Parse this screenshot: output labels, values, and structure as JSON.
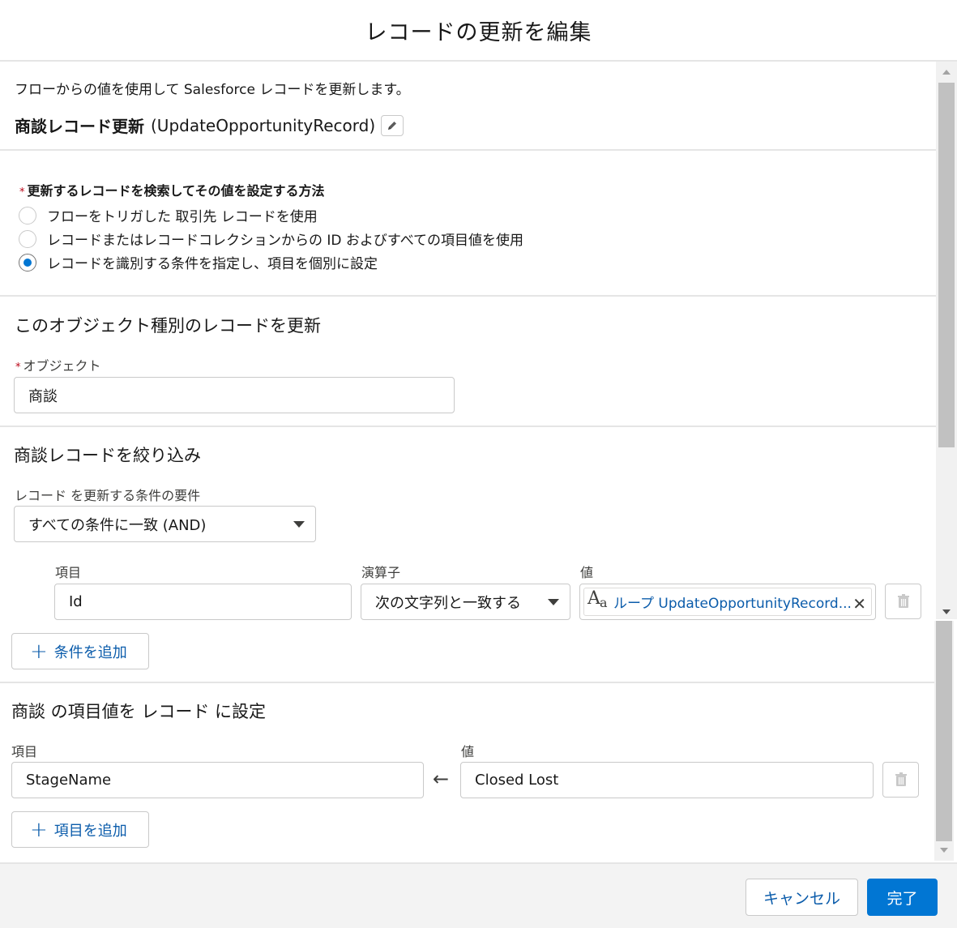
{
  "modal": {
    "title": "レコードの更新を編集"
  },
  "intro": {
    "description": "フローからの値を使用して Salesforce レコードを更新します。",
    "element_label": "商談レコード更新",
    "element_api_name": "(UpdateOpportunityRecord)"
  },
  "method": {
    "label": "更新するレコードを検索してその値を設定する方法",
    "required_marker": "*",
    "options": [
      {
        "label": "フローをトリガした 取引先 レコードを使用",
        "selected": false
      },
      {
        "label": "レコードまたはレコードコレクションからの ID およびすべての項目値を使用",
        "selected": false
      },
      {
        "label": "レコードを識別する条件を指定し、項目を個別に設定",
        "selected": true
      }
    ]
  },
  "object_section": {
    "title": "このオブジェクト種別のレコードを更新",
    "object_label": "オブジェクト",
    "required_marker": "*",
    "object_value": "商談"
  },
  "filter_section": {
    "title": "商談レコードを絞り込み",
    "requirement_label": "レコード を更新する条件の要件",
    "requirement_value": "すべての条件に一致 (AND)",
    "columns": {
      "field": "項目",
      "operator": "演算子",
      "value": "値"
    },
    "conditions": [
      {
        "field": "Id",
        "operator": "次の文字列と一致する",
        "value_icon": "text-variable-icon",
        "value_icon_big": "A",
        "value_icon_small": "a",
        "value": "ループ UpdateOpportunityRecord..."
      }
    ],
    "add_condition_label": "条件を追加"
  },
  "assign_section": {
    "title": "商談 の項目値を レコード に設定",
    "columns": {
      "field": "項目",
      "value": "値"
    },
    "assignments": [
      {
        "field": "StageName",
        "value": "Closed Lost"
      }
    ],
    "add_field_label": "項目を追加"
  },
  "footer": {
    "cancel_label": "キャンセル",
    "done_label": "完了"
  },
  "colors": {
    "brand": "#0176d3",
    "link": "#0b5cab",
    "required": "#ba0517",
    "border": "#c9c9c9"
  }
}
